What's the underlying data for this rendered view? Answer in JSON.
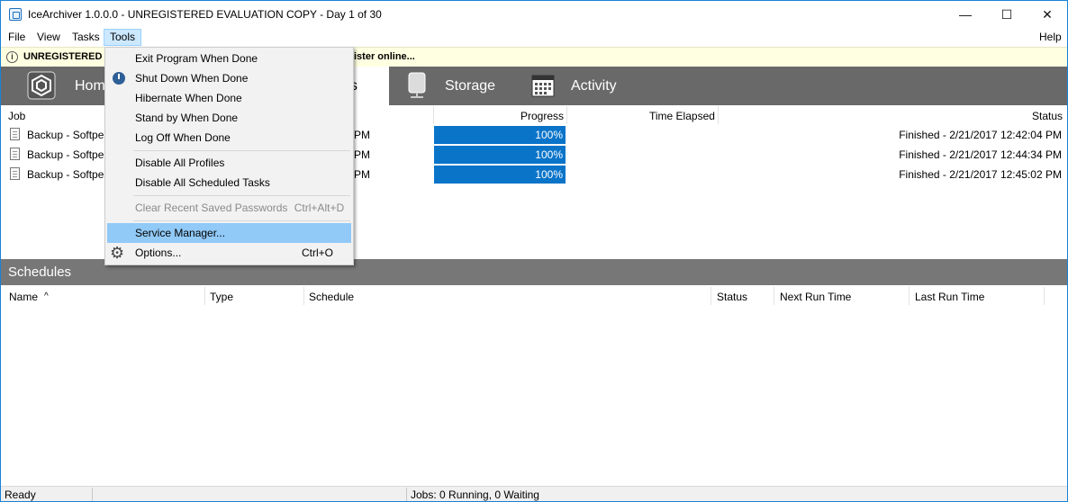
{
  "window": {
    "title": "IceArchiver 1.0.0.0 - UNREGISTERED EVALUATION COPY - Day 1 of 30",
    "minimize_glyph": "—",
    "maximize_glyph": "☐",
    "close_glyph": "✕"
  },
  "menubar": {
    "file": "File",
    "view": "View",
    "tasks": "Tasks",
    "tools": "Tools",
    "help": "Help"
  },
  "infobar": {
    "icon": "i",
    "left_text": "UNREGISTERED",
    "right_text": "ister online..."
  },
  "nav": {
    "home": "Hom",
    "jobs_partial": "s",
    "storage": "Storage",
    "activity": "Activity"
  },
  "jobs": {
    "columns": {
      "job": "Job",
      "progress": "Progress",
      "time_elapsed": "Time Elapsed",
      "status": "Status"
    },
    "rows": [
      {
        "name": "Backup - Softpe",
        "time": "PM",
        "progress": 1.0,
        "progress_text": "100%",
        "status": "Finished - 2/21/2017 12:42:04 PM"
      },
      {
        "name": "Backup - Softpe",
        "time": "PM",
        "progress": 1.0,
        "progress_text": "100%",
        "status": "Finished - 2/21/2017 12:44:34 PM"
      },
      {
        "name": "Backup - Softpe",
        "time": "PM",
        "progress": 1.0,
        "progress_text": "100%",
        "status": "Finished - 2/21/2017 12:45:02 PM"
      }
    ]
  },
  "schedules": {
    "title": "Schedules",
    "columns": {
      "name": "Name",
      "sort_glyph": "^",
      "type": "Type",
      "schedule": "Schedule",
      "status": "Status",
      "next_run": "Next Run Time",
      "last_run": "Last Run Time"
    }
  },
  "statusbar": {
    "left": "Ready",
    "middle": "Jobs: 0 Running, 0 Waiting"
  },
  "tools_menu": {
    "exit_when_done": "Exit Program When Done",
    "shutdown_when_done": "Shut Down When Done",
    "hibernate_when_done": "Hibernate When Done",
    "standby_when_done": "Stand by When Done",
    "logoff_when_done": "Log Off When Done",
    "disable_profiles": "Disable All Profiles",
    "disable_scheduled": "Disable All Scheduled Tasks",
    "clear_passwords": "Clear Recent Saved Passwords",
    "clear_passwords_shortcut": "Ctrl+Alt+D",
    "service_manager": "Service Manager...",
    "options": "Options...",
    "options_shortcut": "Ctrl+O"
  },
  "colors": {
    "accent": "#0a74c9",
    "nav_bg": "#696969",
    "menu_highlight": "#91c9f7",
    "info_bg": "#ffffe1"
  }
}
